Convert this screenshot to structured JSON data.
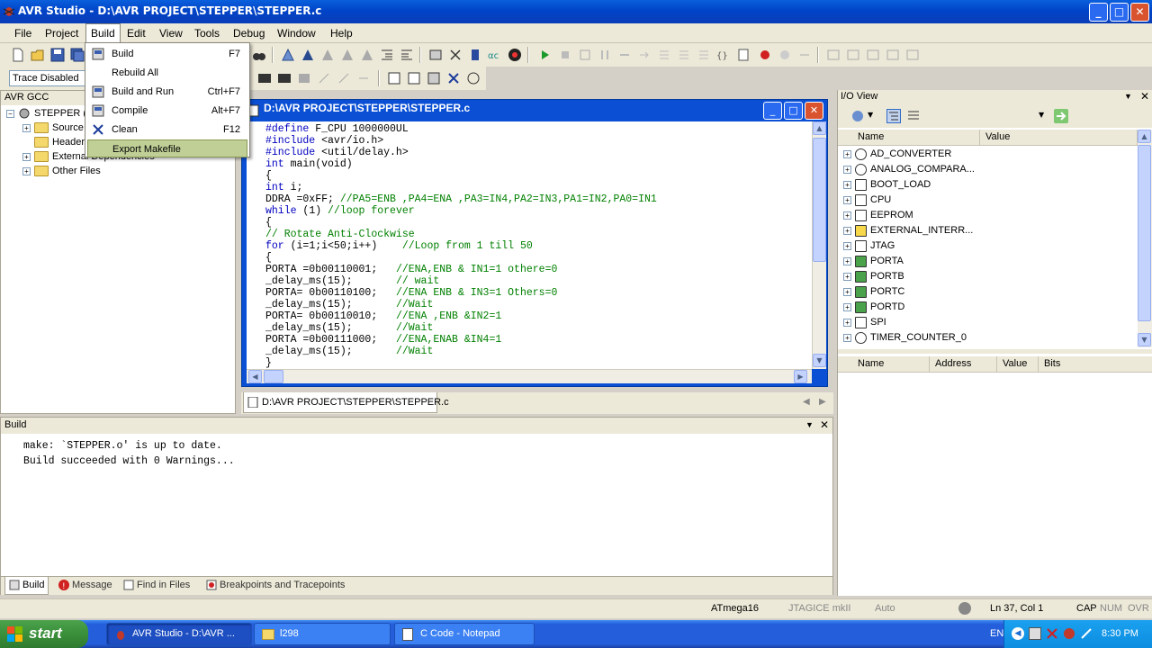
{
  "window": {
    "title": "AVR Studio - D:\\AVR PROJECT\\STEPPER\\STEPPER.c",
    "minimize": "_",
    "maximize": "□",
    "close": "✕"
  },
  "menubar": [
    "File",
    "Project",
    "Build",
    "Edit",
    "View",
    "Tools",
    "Debug",
    "Window",
    "Help"
  ],
  "build_menu": {
    "items": [
      {
        "label": "Build",
        "shortcut": "F7"
      },
      {
        "label": "Rebuild All",
        "shortcut": ""
      },
      {
        "label": "Build and Run",
        "shortcut": "Ctrl+F7"
      },
      {
        "label": "Compile",
        "shortcut": "Alt+F7"
      },
      {
        "label": "Clean",
        "shortcut": "F12"
      },
      {
        "label": "Export Makefile",
        "shortcut": ""
      }
    ]
  },
  "toolbar2": {
    "trace_select": "Trace Disabled"
  },
  "project_panel": {
    "title": "AVR GCC",
    "root": "STEPPER (",
    "children": [
      "Source",
      "Header",
      "External Dependencies",
      "Other Files"
    ]
  },
  "editor": {
    "title": "D:\\AVR PROJECT\\STEPPER\\STEPPER.c",
    "tab": "D:\\AVR PROJECT\\STEPPER\\STEPPER.c",
    "lines": [
      {
        "kw": "#define",
        "code": " F_CPU 1000000UL",
        "cm": ""
      },
      {
        "kw": "#include",
        "code": " <avr/io.h>",
        "cm": ""
      },
      {
        "kw": "#include",
        "code": " <util/delay.h>",
        "cm": ""
      },
      {
        "kw": "int",
        "code": " main(void)",
        "cm": ""
      },
      {
        "kw": "",
        "code": "{",
        "cm": ""
      },
      {
        "kw": "int",
        "code": " i;",
        "cm": ""
      },
      {
        "kw": "",
        "code": "DDRA =0xFF; ",
        "cm": "//PA5=ENB ,PA4=ENA ,PA3=IN4,PA2=IN3,PA1=IN2,PA0=IN1"
      },
      {
        "kw": "while",
        "code": " (1) ",
        "cm": "//loop forever"
      },
      {
        "kw": "",
        "code": "{",
        "cm": ""
      },
      {
        "kw": "",
        "code": "",
        "cm": "// Rotate Anti-Clockwise"
      },
      {
        "kw": "for",
        "code": " (i=1;i<50;i++)    ",
        "cm": "//Loop from 1 till 50"
      },
      {
        "kw": "",
        "code": "{",
        "cm": ""
      },
      {
        "kw": "",
        "code": "PORTA =0b00110001;   ",
        "cm": "//ENA,ENB & IN1=1 othere=0"
      },
      {
        "kw": "",
        "code": "_delay_ms(15);       ",
        "cm": "// wait"
      },
      {
        "kw": "",
        "code": "PORTA= 0b00110100;   ",
        "cm": "//ENA ENB & IN3=1 Others=0"
      },
      {
        "kw": "",
        "code": "_delay_ms(15);       ",
        "cm": "//Wait"
      },
      {
        "kw": "",
        "code": "PORTA= 0b00110010;   ",
        "cm": "//ENA ,ENB &IN2=1"
      },
      {
        "kw": "",
        "code": "_delay_ms(15);       ",
        "cm": "//Wait"
      },
      {
        "kw": "",
        "code": "PORTA =0b00111000;   ",
        "cm": "//ENA,ENAB &IN4=1"
      },
      {
        "kw": "",
        "code": "_delay_ms(15);       ",
        "cm": "//Wait"
      },
      {
        "kw": "",
        "code": "}",
        "cm": ""
      }
    ]
  },
  "io_view": {
    "title": "I/O View",
    "columns": [
      "Name",
      "Value"
    ],
    "items": [
      "AD_CONVERTER",
      "ANALOG_COMPARA...",
      "BOOT_LOAD",
      "CPU",
      "EEPROM",
      "EXTERNAL_INTERR...",
      "JTAG",
      "PORTA",
      "PORTB",
      "PORTC",
      "PORTD",
      "SPI",
      "TIMER_COUNTER_0"
    ],
    "detail_columns": [
      "Name",
      "Address",
      "Value",
      "Bits"
    ]
  },
  "build_panel": {
    "title": "Build",
    "lines": [
      "make: `STEPPER.o' is up to date.",
      "Build succeeded with 0 Warnings..."
    ],
    "tabs": [
      "Build",
      "Message",
      "Find in Files",
      "Breakpoints and Tracepoints"
    ]
  },
  "statusbar": {
    "device": "ATmega16",
    "debugger": "JTAGICE mkII",
    "mode": "Auto",
    "position": "Ln 37, Col 1",
    "cap": "CAP",
    "num": "NUM",
    "ovr": "OVR"
  },
  "taskbar": {
    "start": "start",
    "tasks": [
      "AVR Studio - D:\\AVR ...",
      "l298",
      "C Code - Notepad"
    ],
    "lang": "EN",
    "clock": "8:30 PM"
  },
  "colors": {
    "title_blue": "#0044c8",
    "menu_highlight": "#bfcf96",
    "keyword": "#0000c0",
    "comment": "#008000"
  }
}
